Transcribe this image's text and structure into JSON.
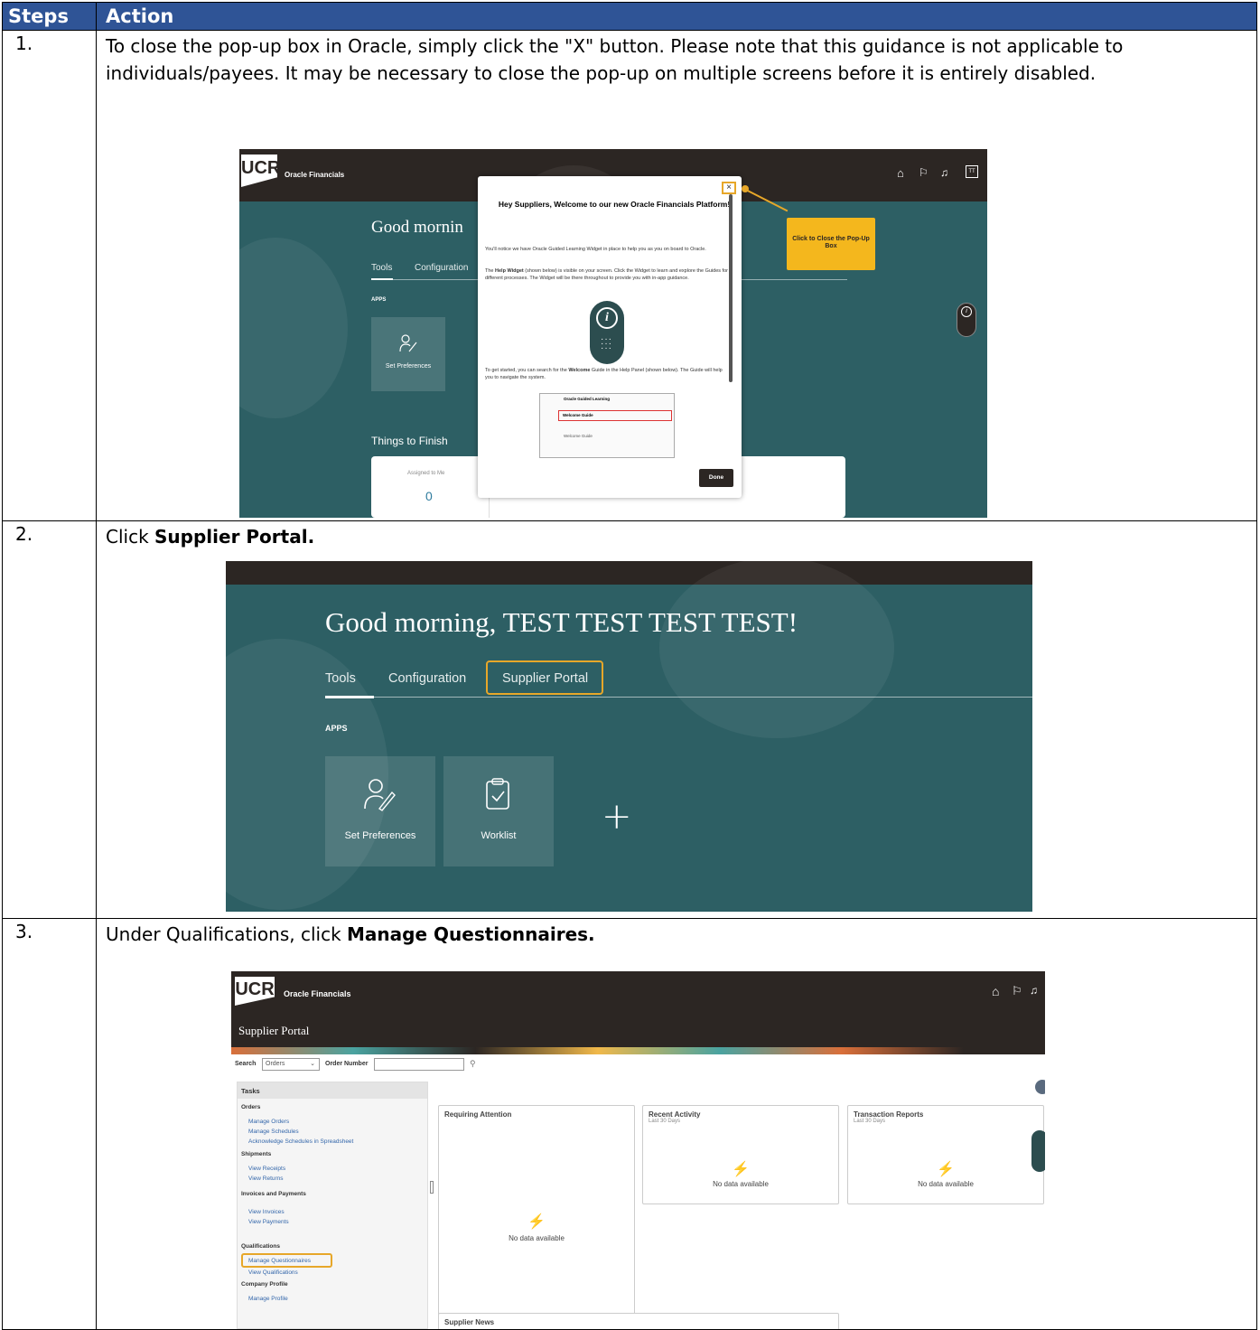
{
  "table": {
    "header_step": "Steps",
    "header_action": "Action"
  },
  "rows": [
    {
      "num": "1.",
      "text": "To close the pop-up box in Oracle, simply click the \"X\" button. Please note that this guidance is not applicable to individuals/payees. It may be necessary to close the pop-up on multiple screens before it is entirely disabled."
    },
    {
      "num": "2.",
      "text_prefix": "Click ",
      "text_bold": "Supplier Portal."
    },
    {
      "num": "3.",
      "text_prefix": "Under Qualifications, click ",
      "text_bold": "Manage Questionnaires."
    }
  ],
  "shot1": {
    "logo": "UCR",
    "brand": "Oracle Financials",
    "greeting": "Good mornin",
    "tabs": [
      "Tools",
      "Configuration"
    ],
    "apps_label": "APPS",
    "card_label": "Set Preferences",
    "things_to_finish": "Things to Finish",
    "assigned_label": "Assigned to Me",
    "assigned_count": "0",
    "avatar": "TT",
    "popup": {
      "close": "×",
      "title": "Hey Suppliers, Welcome to our new Oracle Financials Platform!",
      "p1": "You'll notice we have Oracle Guided Learning Widget in place to help you as you on board to Oracle.",
      "p2_prefix": "The ",
      "p2_bold": "Help Widget",
      "p2_rest": " (shown below) is visible on your screen. Click the Widget to learn and explore the Guides for different processes. The Widget will be there throughout to provide you with in-app guidance.",
      "p3_prefix": "To get started, you can search for the ",
      "p3_bold": "Welcome",
      "p3_rest": " Guide in the Help Panel (shown below). The Guide will help you to navigate the system.",
      "mini_title": "Oracle Guided Learning",
      "mini_search": "Welcome Guide",
      "mini_item": "Welcome Guide",
      "done": "Done"
    },
    "callout": "Click to Close the Pop-Up Box"
  },
  "shot2": {
    "greeting": "Good morning, TEST TEST TEST TEST!",
    "tabs": [
      "Tools",
      "Configuration",
      "Supplier Portal"
    ],
    "apps_label": "APPS",
    "cards": [
      "Set Preferences",
      "Worklist"
    ],
    "plus": "+"
  },
  "shot3": {
    "logo": "UCR",
    "brand": "Oracle Financials",
    "page_title": "Supplier Portal",
    "search_label": "Search",
    "search_value": "Orders",
    "order_number_label": "Order Number",
    "tasks_title": "Tasks",
    "groups": {
      "orders": "Orders",
      "shipments": "Shipments",
      "invoices": "Invoices and Payments",
      "qualifications": "Qualifications",
      "company": "Company Profile"
    },
    "links": {
      "manage_orders": "Manage Orders",
      "manage_schedules": "Manage Schedules",
      "ack_schedules": "Acknowledge Schedules in Spreadsheet",
      "view_receipts": "View Receipts",
      "view_returns": "View Returns",
      "view_invoices": "View Invoices",
      "view_payments": "View Payments",
      "manage_questionnaires": "Manage Questionnaires",
      "view_qualifications": "View Qualifications",
      "manage_profile": "Manage Profile"
    },
    "tiles": {
      "requiring_attention": "Requiring Attention",
      "recent_activity": "Recent Activity",
      "transaction_reports": "Transaction Reports",
      "last_30": "Last 30 Days",
      "no_data": "No data available",
      "supplier_news": "Supplier News"
    }
  },
  "colors": {
    "header_blue": "#2f5496",
    "oracle_teal": "#2d5f64",
    "oracle_dark": "#2c2623",
    "highlight": "#e7a729",
    "link_blue": "#3366aa"
  }
}
